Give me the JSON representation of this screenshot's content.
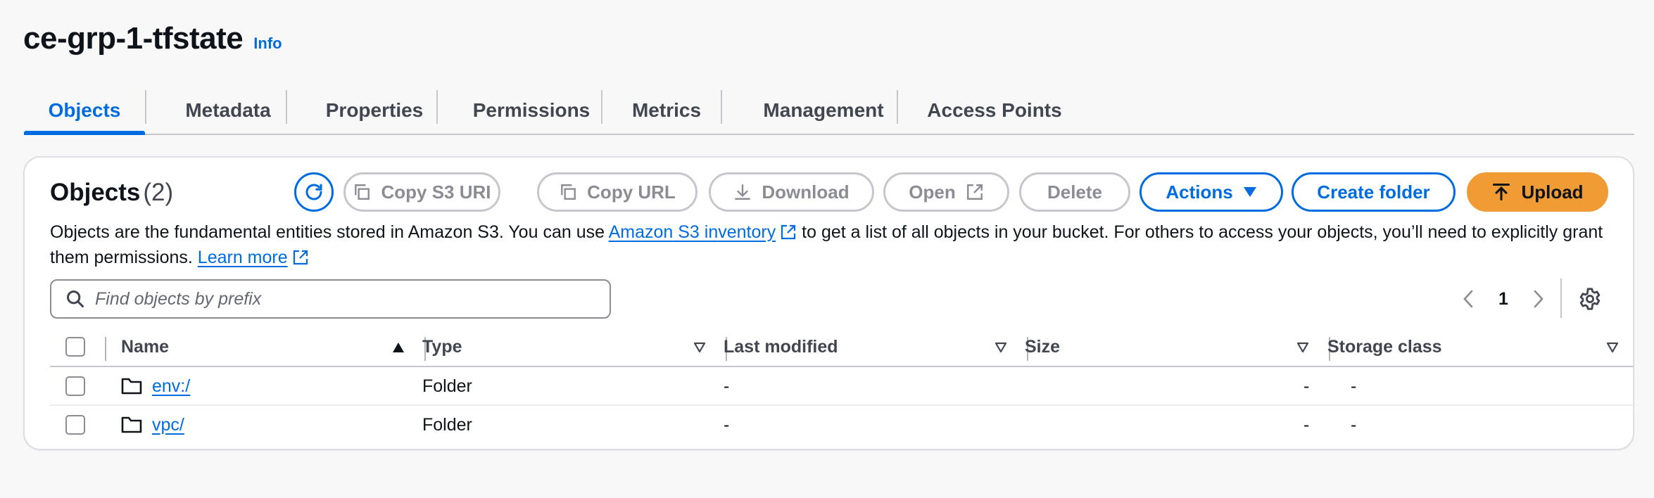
{
  "header": {
    "title": "ce-grp-1-tfstate",
    "info_label": "Info"
  },
  "tabs": [
    {
      "label": "Objects",
      "active": true
    },
    {
      "label": "Metadata"
    },
    {
      "label": "Properties"
    },
    {
      "label": "Permissions"
    },
    {
      "label": "Metrics"
    },
    {
      "label": "Management"
    },
    {
      "label": "Access Points"
    }
  ],
  "objects_panel": {
    "title": "Objects",
    "count": "(2)",
    "buttons": {
      "copy_s3_uri": "Copy S3 URI",
      "copy_url": "Copy URL",
      "download": "Download",
      "open": "Open",
      "delete": "Delete",
      "actions": "Actions",
      "create_folder": "Create folder",
      "upload": "Upload"
    },
    "description": {
      "part1": "Objects are the fundamental entities stored in Amazon S3. You can use ",
      "inventory_link": "Amazon S3 inventory",
      "part2": " to get a list of all objects in your bucket. For others to access your objects, you’ll need to explicitly grant them permissions. ",
      "learn_more": "Learn more"
    },
    "search": {
      "placeholder": "Find objects by prefix"
    },
    "pagination": {
      "current_page": "1"
    },
    "table": {
      "columns": [
        "Name",
        "Type",
        "Last modified",
        "Size",
        "Storage class"
      ],
      "rows": [
        {
          "name": "env:/",
          "type": "Folder",
          "last_modified": "-",
          "size": "-",
          "storage_class": "-"
        },
        {
          "name": "vpc/",
          "type": "Folder",
          "last_modified": "-",
          "size": "-",
          "storage_class": "-"
        }
      ]
    }
  },
  "colors": {
    "accent": "#006ce0",
    "upload": "#f19b35",
    "disabled": "#8c8c94",
    "text": "#0f141a"
  }
}
